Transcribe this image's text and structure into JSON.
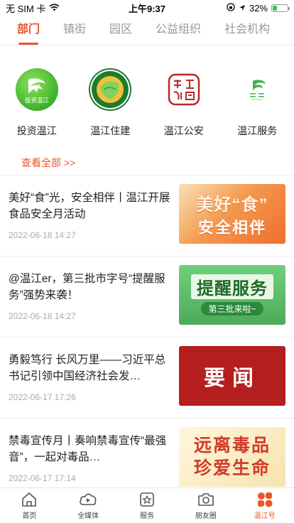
{
  "status": {
    "carrier": "无 SIM 卡",
    "time": "上午9:37",
    "battery": "32%",
    "battery_level": 0.32
  },
  "tabs": [
    {
      "label": "部门",
      "active": true
    },
    {
      "label": "镇街",
      "active": false
    },
    {
      "label": "园区",
      "active": false
    },
    {
      "label": "公益组织",
      "active": false
    },
    {
      "label": "社会机构",
      "active": false
    }
  ],
  "departments": [
    {
      "name": "投资温江",
      "logo_text": "投资温江",
      "icon": "invest-wenjiang-logo-icon"
    },
    {
      "name": "温江住建",
      "icon": "wenjiang-construction-logo-icon"
    },
    {
      "name": "温江公安",
      "icon": "wenjiang-police-seal-icon"
    },
    {
      "name": "温江服务",
      "icon": "wenjiang-service-logo-icon"
    }
  ],
  "view_all": "查看全部 >>",
  "news": [
    {
      "title": "美好“食”光，安全相伴丨温江开展食品安全月活动",
      "time": "2022-06-18 14:27",
      "thumb_line1": "美好“食”",
      "thumb_line2": "安全相伴"
    },
    {
      "title": "@温江er，第三批市字号“提醒服务”强势来袭！",
      "time": "2022-06-18 14:27",
      "thumb_line1": "提醒服务",
      "thumb_line2": "第三批来啦~"
    },
    {
      "title": "勇毅笃行 长风万里——习近平总书记引领中国经济社会发…",
      "time": "2022-06-17 17:26",
      "thumb_line1": "要闻"
    },
    {
      "title": "禁毒宣传月丨奏响禁毒宣传“最强音”，一起对毒品…",
      "time": "2022-06-17 17:14",
      "thumb_line1": "远离毒品",
      "thumb_line2": "珍爱生命"
    }
  ],
  "bottom_nav": [
    {
      "label": "首页",
      "icon": "home-icon",
      "active": false
    },
    {
      "label": "全媒体",
      "icon": "media-play-icon",
      "active": false
    },
    {
      "label": "服务",
      "icon": "service-star-icon",
      "active": false
    },
    {
      "label": "朋友圈",
      "icon": "camera-icon",
      "active": false
    },
    {
      "label": "温江号",
      "icon": "wenjiang-account-icon",
      "active": true
    }
  ],
  "colors": {
    "accent": "#e8572a",
    "text": "#222222",
    "muted": "#aaaaaa"
  }
}
